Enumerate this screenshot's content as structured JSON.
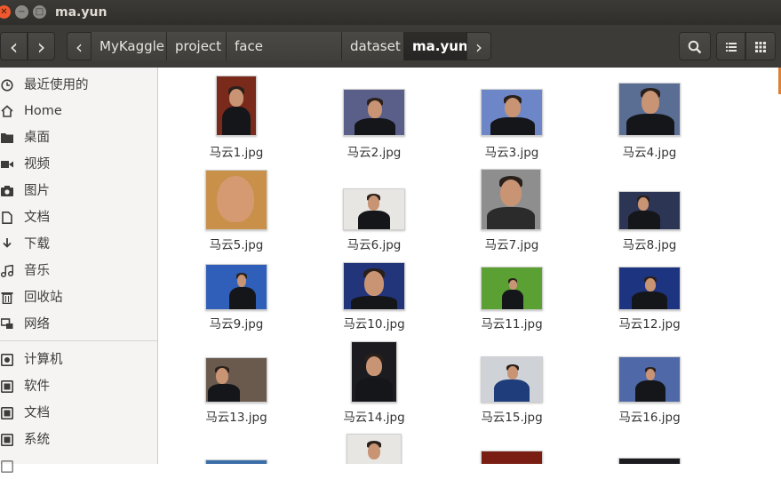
{
  "window": {
    "title": "ma.yun",
    "close_glyph": "✕",
    "min_glyph": "−",
    "max_glyph": "□"
  },
  "toolbar": {
    "back_glyph": "‹",
    "forward_glyph": "›",
    "crumb_left_glyph": "‹",
    "crumb_right_glyph": "›",
    "search_icon": "search-icon",
    "list_icon": "list-view-icon",
    "grid_icon": "grid-view-icon",
    "breadcrumbs": [
      "MyKaggle",
      "project",
      "face recognition",
      "dataset",
      "ma.yun"
    ]
  },
  "sidebar": {
    "places": [
      {
        "label": "最近使用的",
        "icon": "clock-icon"
      },
      {
        "label": "Home",
        "icon": "home-icon"
      },
      {
        "label": "桌面",
        "icon": "folder-icon"
      },
      {
        "label": "视频",
        "icon": "video-icon"
      },
      {
        "label": "图片",
        "icon": "camera-icon"
      },
      {
        "label": "文档",
        "icon": "document-icon"
      },
      {
        "label": "下载",
        "icon": "download-icon"
      },
      {
        "label": "音乐",
        "icon": "music-icon"
      },
      {
        "label": "回收站",
        "icon": "trash-icon"
      },
      {
        "label": "网络",
        "icon": "network-icon"
      }
    ],
    "devices": [
      {
        "label": "计算机",
        "icon": "computer-icon"
      },
      {
        "label": "软件",
        "icon": "drive-icon"
      },
      {
        "label": "文档",
        "icon": "drive-icon"
      },
      {
        "label": "系统",
        "icon": "drive-icon"
      }
    ]
  },
  "files": [
    {
      "name": "马云1.jpg",
      "bg": "#7a2a1a"
    },
    {
      "name": "马云2.jpg",
      "bg": "#5a5f8a"
    },
    {
      "name": "马云3.jpg",
      "bg": "#6d86c7"
    },
    {
      "name": "马云4.jpg",
      "bg": "#5a6d93"
    },
    {
      "name": "马云5.jpg",
      "bg": "#c9904a"
    },
    {
      "name": "马云6.jpg",
      "bg": "#e8e6e3"
    },
    {
      "name": "马云7.jpg",
      "bg": "#8e8e8e"
    },
    {
      "name": "马云8.jpg",
      "bg": "#2d3554"
    },
    {
      "name": "马云9.jpg",
      "bg": "#2f5fb8"
    },
    {
      "name": "马云10.jpg",
      "bg": "#22347a"
    },
    {
      "name": "马云11.jpg",
      "bg": "#5aa033"
    },
    {
      "name": "马云12.jpg",
      "bg": "#1d3580"
    },
    {
      "name": "马云13.jpg",
      "bg": "#6a5a4e"
    },
    {
      "name": "马云14.jpg",
      "bg": "#1c1c20"
    },
    {
      "name": "马云15.jpg",
      "bg": "#cfd3d8"
    },
    {
      "name": "马云16.jpg",
      "bg": "#4e68a8"
    }
  ]
}
